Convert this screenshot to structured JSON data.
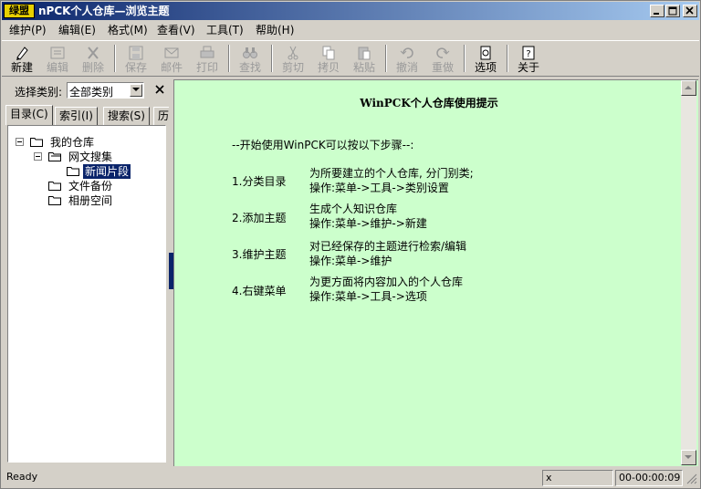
{
  "window": {
    "app_icon_text": "绿盟",
    "title": "nPCK个人仓库—浏览主题"
  },
  "menu": [
    {
      "label": "维护(P)"
    },
    {
      "label": "编辑(E)"
    },
    {
      "label": "格式(M)"
    },
    {
      "label": "查看(V)"
    },
    {
      "label": "工具(T)"
    },
    {
      "label": "帮助(H)"
    }
  ],
  "toolbar": {
    "new": "新建",
    "edit": "编辑",
    "delete": "删除",
    "save": "保存",
    "mail": "邮件",
    "print": "打印",
    "find": "查找",
    "cut": "剪切",
    "copy": "拷贝",
    "paste": "粘贴",
    "undo": "撤消",
    "redo": "重做",
    "options": "选项",
    "about": "关于"
  },
  "left": {
    "category_label": "选择类别:",
    "category_value": "全部类别",
    "tabs": [
      "目录(C)",
      "索引(I)",
      "搜索(S)",
      "历"
    ],
    "tree": {
      "root": "我的仓库",
      "web": "网文搜集",
      "news": "新闻片段",
      "backup": "文件备份",
      "photos": "相册空间"
    }
  },
  "content": {
    "title": "WinPCK个人仓库使用提示",
    "intro": "--开始使用WinPCK可以按以下步骤--:",
    "steps": [
      {
        "label": "1.分类目录",
        "line1": "为所要建立的个人仓库, 分门别类;",
        "line2": "操作:菜单->工具->类别设置"
      },
      {
        "label": "2.添加主题",
        "line1": "生成个人知识仓库",
        "line2": "操作:菜单->维护->新建"
      },
      {
        "label": "3.维护主题",
        "line1": "对已经保存的主题进行检索/编辑",
        "line2": "操作:菜单->维护"
      },
      {
        "label": "4.右键菜单",
        "line1": "为更方面将内容加入的个人仓库",
        "line2": "操作:菜单->工具->选项"
      }
    ]
  },
  "status": {
    "ready": "Ready",
    "x": "x",
    "time": "00-00:00:09"
  }
}
